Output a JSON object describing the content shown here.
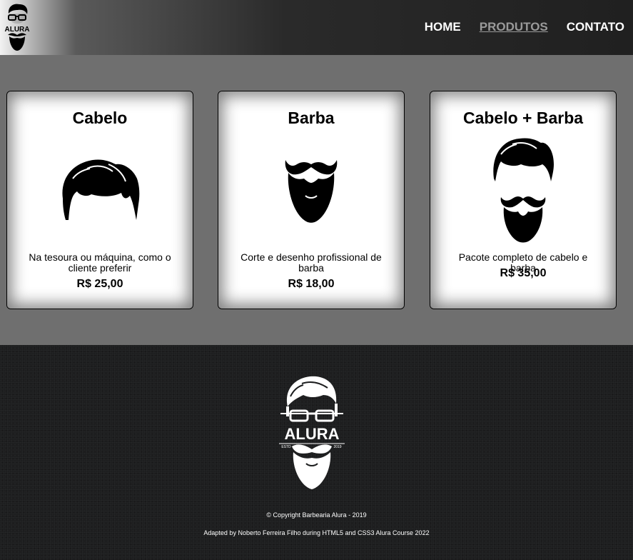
{
  "header": {
    "logo_text": "ALURA",
    "nav": [
      {
        "label": "HOME",
        "active": false
      },
      {
        "label": "PRODUTOS",
        "active": true
      },
      {
        "label": "CONTATO",
        "active": false
      }
    ]
  },
  "products": [
    {
      "title": "Cabelo",
      "description": "Na tesoura ou máquina, como o cliente preferir",
      "price": "R$ 25,00",
      "icon": "hair-icon"
    },
    {
      "title": "Barba",
      "description": "Corte e desenho profissional de barba",
      "price": "R$ 18,00",
      "icon": "beard-icon"
    },
    {
      "title": "Cabelo + Barba",
      "description": "Pacote completo de cabelo e barba",
      "price": "R$ 35,00",
      "icon": "hair-and-beard-icon"
    }
  ],
  "footer": {
    "logo_text": "ALURA",
    "logo_left": "ESTD",
    "logo_right": "2019",
    "copyright": "© Copyright Barbearia Alura - 2019",
    "adapted": "Adapted by Noberto Ferreira Filho during HTML5 and CSS3 Alura Course 2022"
  },
  "colors": {
    "header_dark": "#202020",
    "page_background": "#6f6f6f",
    "footer_background": "#1d1e1f",
    "nav_active": "#9a9a9a"
  }
}
